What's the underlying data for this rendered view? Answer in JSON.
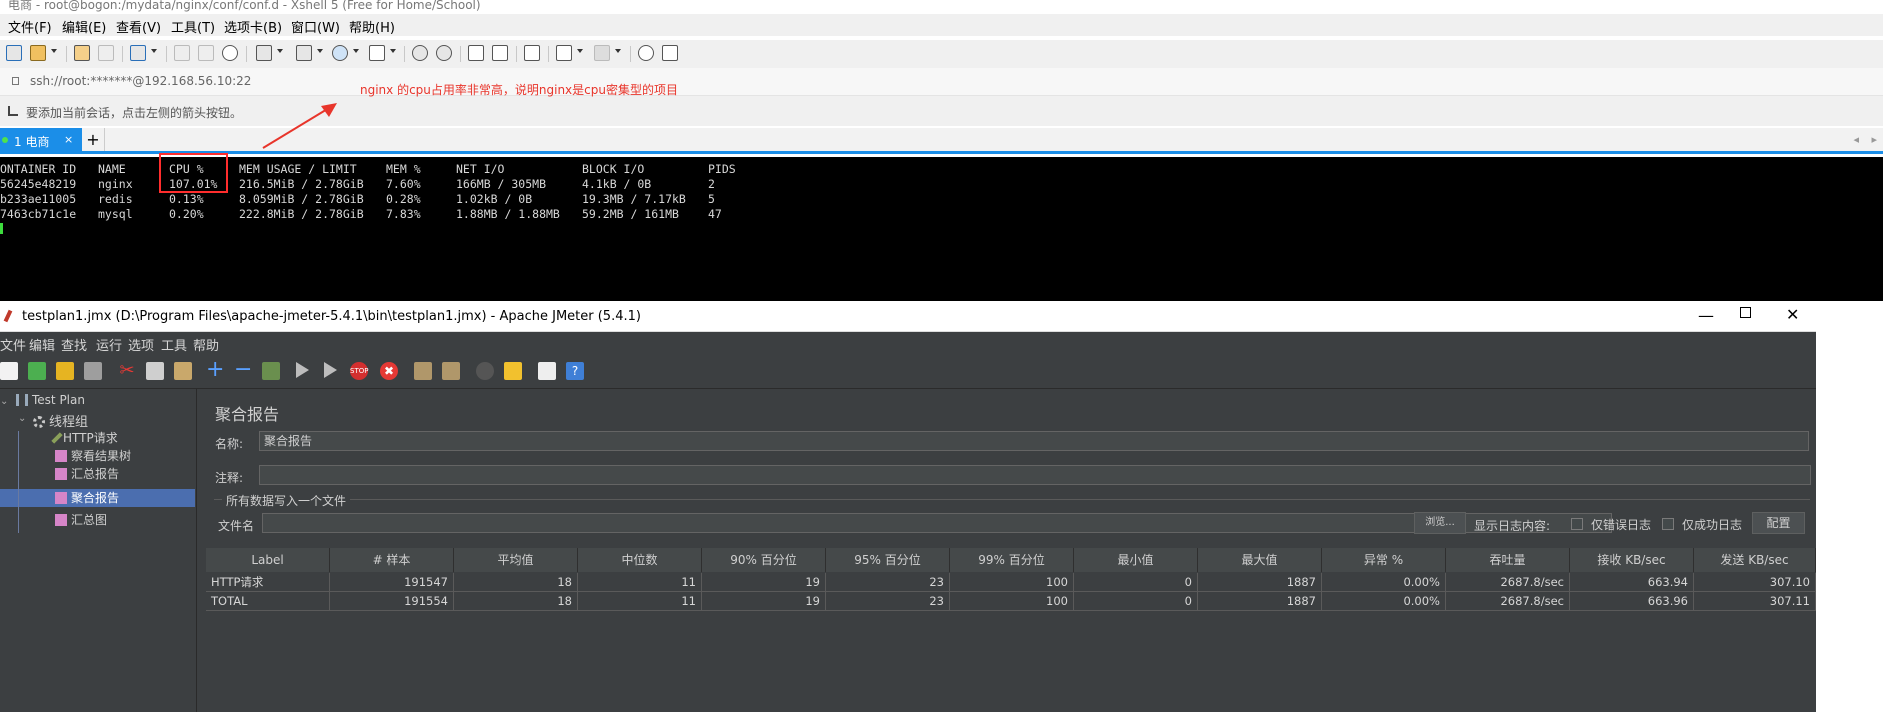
{
  "xshell": {
    "title": "电商 - root@bogon:/mydata/nginx/conf/conf.d - Xshell 5 (Free for Home/School)",
    "menu": [
      "文件(F)",
      "编辑(E)",
      "查看(V)",
      "工具(T)",
      "选项卡(B)",
      "窗口(W)",
      "帮助(H)"
    ],
    "address": "ssh://root:*******@192.168.56.10:22",
    "hint": "要添加当前会话，点击左侧的箭头按钮。",
    "tab_label": "1 电商",
    "tab_close": "×",
    "tab_add": "+",
    "annotation": "nginx  的cpu占用率非常高，说明nginx是cpu密集型的项目",
    "annotation_color": "#e8352b",
    "terminal": {
      "headers": [
        "ONTAINER ID",
        "NAME",
        "CPU %",
        "MEM USAGE / LIMIT",
        "MEM %",
        "NET I/O",
        "BLOCK I/O",
        "PIDS"
      ],
      "rows": [
        [
          "56245e48219",
          "nginx",
          "107.01%",
          "216.5MiB / 2.78GiB",
          "7.60%",
          "166MB / 305MB",
          "4.1kB / 0B",
          "2"
        ],
        [
          "b233ae11005",
          "redis",
          "0.13%",
          "8.059MiB / 2.78GiB",
          "0.28%",
          "1.02kB / 0B",
          "19.3MB / 7.17kB",
          "5"
        ],
        [
          "7463cb71c1e",
          "mysql",
          "0.20%",
          "222.8MiB / 2.78GiB",
          "7.83%",
          "1.88MB / 1.88MB",
          "59.2MB / 161MB",
          "47"
        ]
      ]
    }
  },
  "jmeter": {
    "title": "testplan1.jmx (D:\\Program Files\\apache-jmeter-5.4.1\\bin\\testplan1.jmx) - Apache JMeter (5.4.1)",
    "menu": [
      "文件",
      "编辑",
      "查找",
      "运行",
      "选项",
      "工具",
      "帮助"
    ],
    "tree": {
      "root": "Test Plan",
      "thread_group": "线程组",
      "items": [
        "HTTP请求",
        "察看结果树",
        "汇总报告",
        "聚合报告",
        "汇总图"
      ]
    },
    "panel": {
      "heading": "聚合报告",
      "name_label": "名称:",
      "name_value": "聚合报告",
      "comment_label": "注释:",
      "comment_value": "",
      "group_title": "所有数据写入一个文件",
      "filename_label": "文件名",
      "browse_button": "浏览...",
      "log_label": "显示日志内容:",
      "errors_only": "仅错误日志",
      "success_only": "仅成功日志",
      "config_button": "配置"
    },
    "table": {
      "headers": [
        "Label",
        "# 样本",
        "平均值",
        "中位数",
        "90% 百分位",
        "95% 百分位",
        "99% 百分位",
        "最小值",
        "最大值",
        "异常 %",
        "吞吐量",
        "接收 KB/sec",
        "发送 KB/sec"
      ],
      "rows": [
        [
          "HTTP请求",
          "191547",
          "18",
          "11",
          "19",
          "23",
          "100",
          "0",
          "1887",
          "0.00%",
          "2687.8/sec",
          "663.94",
          "307.10"
        ],
        [
          "TOTAL",
          "191554",
          "18",
          "11",
          "19",
          "23",
          "100",
          "0",
          "1887",
          "0.00%",
          "2687.8/sec",
          "663.96",
          "307.11"
        ]
      ]
    }
  }
}
